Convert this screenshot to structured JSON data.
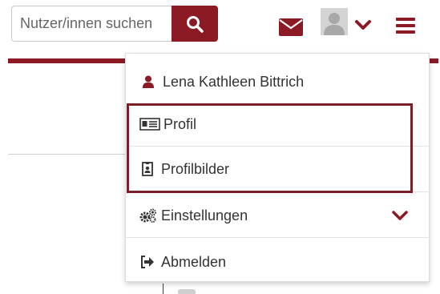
{
  "header": {
    "search": {
      "placeholder": "Nutzer/innen suchen",
      "value": ""
    },
    "icons": {
      "search": "search-icon",
      "mail": "envelope-icon",
      "avatar": "user-avatar-icon",
      "user_menu_toggle": "chevron-down-icon",
      "main_menu": "hamburger-icon"
    }
  },
  "dropdown": {
    "user_name": "Lena Kathleen Bittrich",
    "items": [
      {
        "label": "Profil",
        "icon": "id-card-icon"
      },
      {
        "label": "Profilbilder",
        "icon": "portrait-icon"
      },
      {
        "label": "Einstellungen",
        "icon": "gears-icon",
        "has_submenu": true
      },
      {
        "label": "Abmelden",
        "icon": "sign-out-icon"
      }
    ]
  },
  "colors": {
    "brand": "#8b1a24",
    "highlight_border": "#7a1f27",
    "avatar_bg": "#d4d4d4"
  }
}
